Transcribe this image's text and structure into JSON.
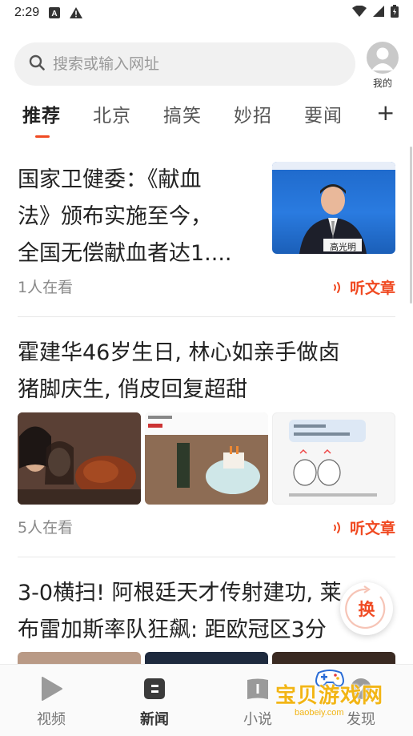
{
  "status_bar": {
    "time": "2:29"
  },
  "search": {
    "placeholder": "搜索或输入网址"
  },
  "profile": {
    "label": "我的"
  },
  "tabs": [
    {
      "label": "推荐",
      "active": true
    },
    {
      "label": "北京"
    },
    {
      "label": "搞笑"
    },
    {
      "label": "妙招"
    },
    {
      "label": "要闻"
    },
    {
      "label": "+"
    }
  ],
  "feed": [
    {
      "headline_lines": [
        "国家卫健委：《献血",
        "法》颁布实施至今，",
        "全国无偿献血者达1...."
      ],
      "meta": "1人在看",
      "listen_label": "听文章",
      "thumb_caption": "高光明"
    },
    {
      "headline_lines": [
        "霍建华46岁生日, 林心如亲手做卤",
        "猪脚庆生, 俏皮回复超甜"
      ],
      "meta": "5人在看",
      "listen_label": "听文章"
    },
    {
      "headline_lines": [
        "3-0横扫! 阿根廷天才传射建功, 莱",
        "布雷加斯率队狂飙: 距欧冠区3分"
      ]
    }
  ],
  "refresh_button": {
    "label": "换"
  },
  "bottom_nav": [
    {
      "label": "视频",
      "icon": "play-icon"
    },
    {
      "label": "新闻",
      "icon": "news-icon",
      "active": true
    },
    {
      "label": "小说",
      "icon": "book-icon"
    },
    {
      "label": "发现",
      "icon": "discover-icon"
    }
  ],
  "watermark": {
    "text": "宝贝游戏网",
    "url": "baobeiy.com"
  },
  "colors": {
    "accent": "#f04a22",
    "watermark": "#f2b515"
  }
}
